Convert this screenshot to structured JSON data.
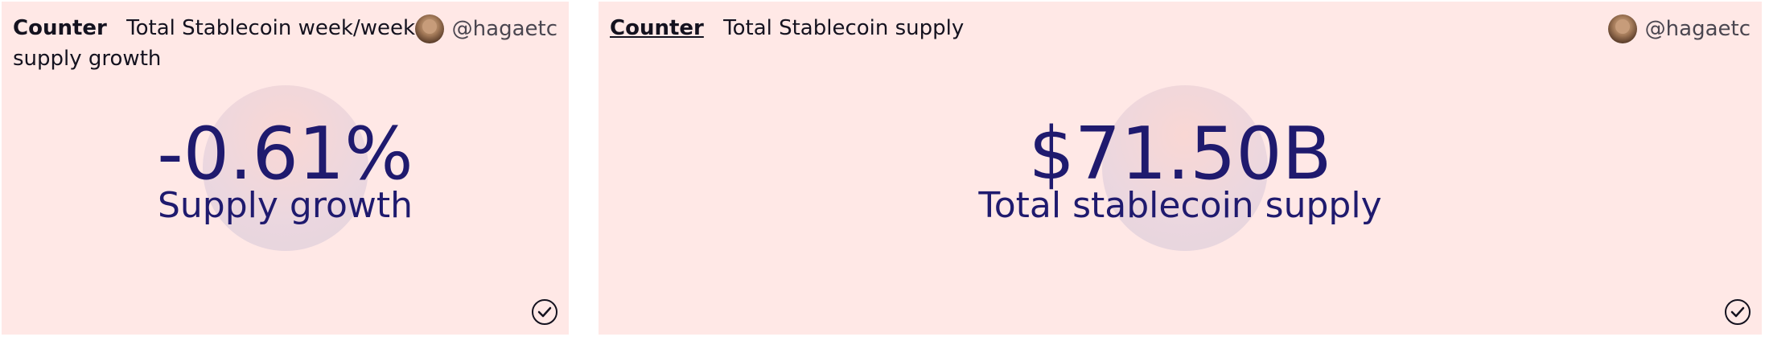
{
  "left_card": {
    "counter_label": "Counter",
    "title": "Total Stablecoin week/week supply growth",
    "author": "@hagaetc",
    "value": "-0.61%",
    "label": "Supply growth",
    "check_icon": "check-circle-icon"
  },
  "right_card": {
    "counter_label": "Counter",
    "title": "Total Stablecoin supply",
    "author": "@hagaetc",
    "value": "$71.50B",
    "label": "Total stablecoin supply",
    "check_icon": "check-circle-icon"
  },
  "colors": {
    "card_bg": "#ffe8e6",
    "value_text": "#1f1a6e",
    "circle": "#ead6df"
  }
}
